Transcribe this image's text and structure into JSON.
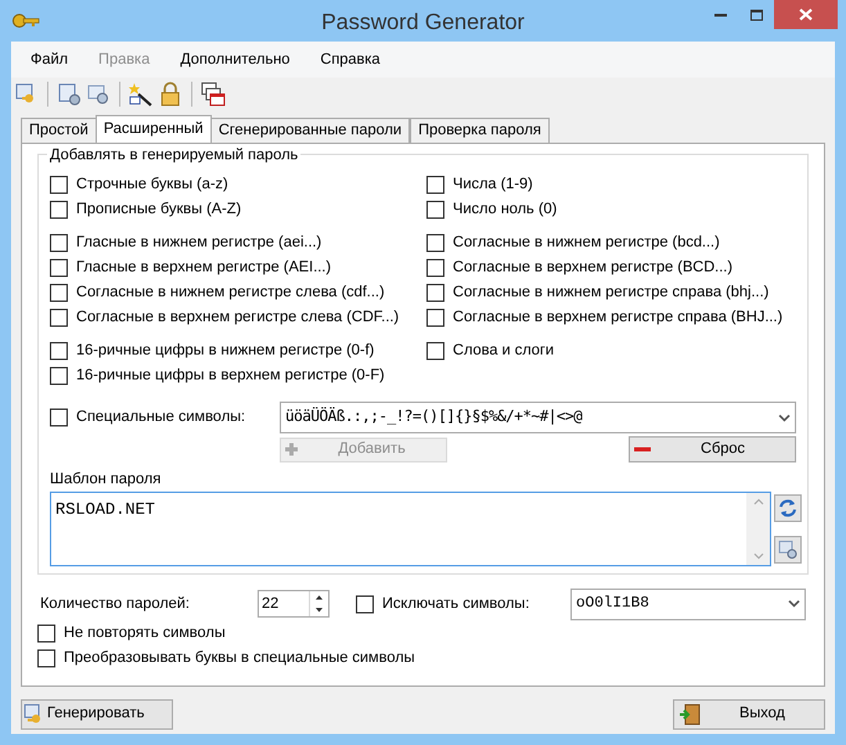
{
  "window": {
    "title": "Password Generator"
  },
  "menu": [
    {
      "label": "Файл",
      "disabled": false
    },
    {
      "label": "Правка",
      "disabled": true
    },
    {
      "label": "Дополнительно",
      "disabled": false
    },
    {
      "label": "Справка",
      "disabled": false
    }
  ],
  "tabs": [
    {
      "label": "Простой",
      "selected": false
    },
    {
      "label": "Расширенный",
      "selected": true
    },
    {
      "label": "Сгенерированные пароли",
      "selected": false
    },
    {
      "label": "Проверка пароля",
      "selected": false
    }
  ],
  "group": {
    "title": "Добавлять в генерируемый пароль",
    "option_groups": [
      {
        "left": [
          {
            "label": "Строчные буквы (a-z)",
            "checked": false
          },
          {
            "label": "Прописные буквы (A-Z)",
            "checked": false
          }
        ],
        "right": [
          {
            "label": "Числа (1-9)",
            "checked": false
          },
          {
            "label": "Число ноль (0)",
            "checked": false
          }
        ]
      },
      {
        "left": [
          {
            "label": "Гласные в нижнем регистре (aei...)",
            "checked": false
          },
          {
            "label": "Гласные в верхнем регистре (AEI...)",
            "checked": false
          },
          {
            "label": "Согласные в нижнем регистре слева (cdf...)",
            "checked": false
          },
          {
            "label": "Согласные в верхнем регистре слева (CDF...)",
            "checked": false
          }
        ],
        "right": [
          {
            "label": "Согласные в нижнем регистре (bcd...)",
            "checked": false
          },
          {
            "label": "Согласные в верхнем регистре (BCD...)",
            "checked": false
          },
          {
            "label": "Согласные в нижнем регистре справа (bhj...)",
            "checked": false
          },
          {
            "label": "Согласные в верхнем регистре справа (BHJ...)",
            "checked": false
          }
        ]
      },
      {
        "left": [
          {
            "label": "16-ричные цифры в нижнем регистре (0-f)",
            "checked": false
          },
          {
            "label": "16-ричные цифры в верхнем регистре (0-F)",
            "checked": false
          }
        ],
        "right": [
          {
            "label": "Слова и слоги",
            "checked": false
          }
        ]
      }
    ],
    "special": {
      "label": "Специальные символы:",
      "checked": false,
      "value": "üöäÜÖÄß.:,;-_!?=()[]{}§$%&/+*~#|<>@"
    },
    "add_button": {
      "label": "Добавить",
      "disabled": true
    },
    "reset_button": {
      "label": "Сброс",
      "disabled": false
    },
    "template": {
      "label": "Шаблон пароля",
      "value": "RSLOAD.NET"
    }
  },
  "count": {
    "label": "Количество паролей:",
    "value": "22"
  },
  "exclude": {
    "label": "Исключать символы:",
    "checked": false,
    "value": "oO0lI1B8"
  },
  "options": [
    {
      "label": "Не повторять символы",
      "checked": false
    },
    {
      "label": "Преобразовывать буквы в специальные символы",
      "checked": false
    }
  ],
  "buttons": {
    "generate": "Генерировать",
    "exit": "Выход"
  }
}
